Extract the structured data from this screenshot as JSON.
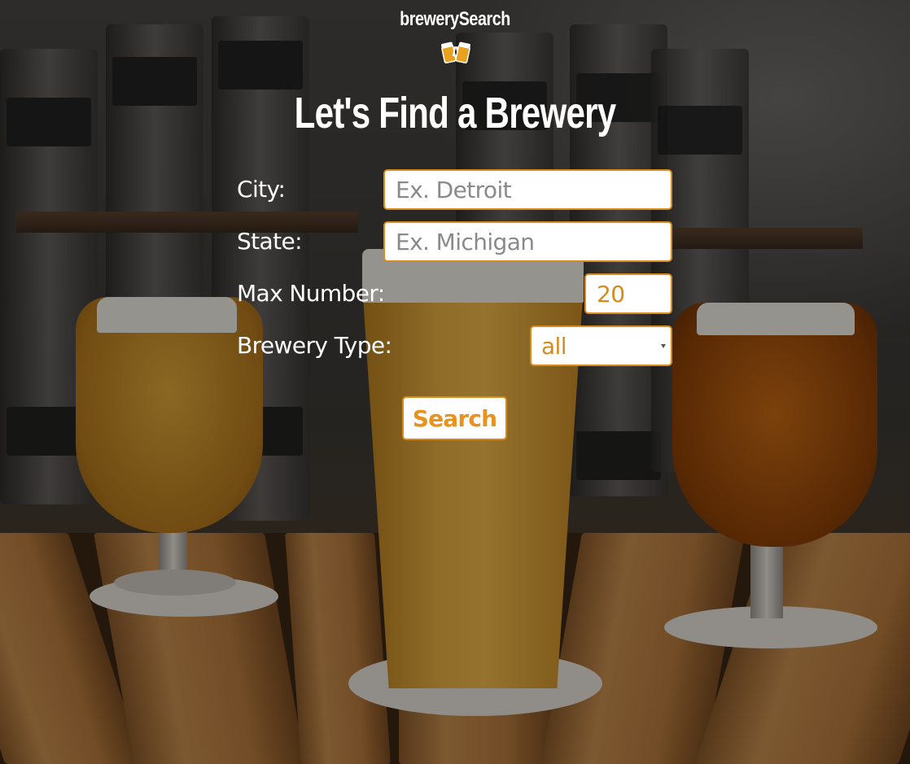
{
  "brand": {
    "name": "brewerySearch",
    "icon": "beer-mugs-icon"
  },
  "page": {
    "heading": "Let's Find a Brewery"
  },
  "form": {
    "city": {
      "label": "City:",
      "placeholder": "Ex. Detroit",
      "value": ""
    },
    "state": {
      "label": "State:",
      "placeholder": "Ex. Michigan",
      "value": ""
    },
    "max_number": {
      "label": "Max Number:",
      "value": "20"
    },
    "brewery_type": {
      "label": "Brewery Type:",
      "selected": "all"
    },
    "submit_label": "Search"
  },
  "colors": {
    "accent": "#d98a1c",
    "button_text": "#e8921f",
    "text": "#ffffff",
    "field_bg": "#ffffff"
  }
}
